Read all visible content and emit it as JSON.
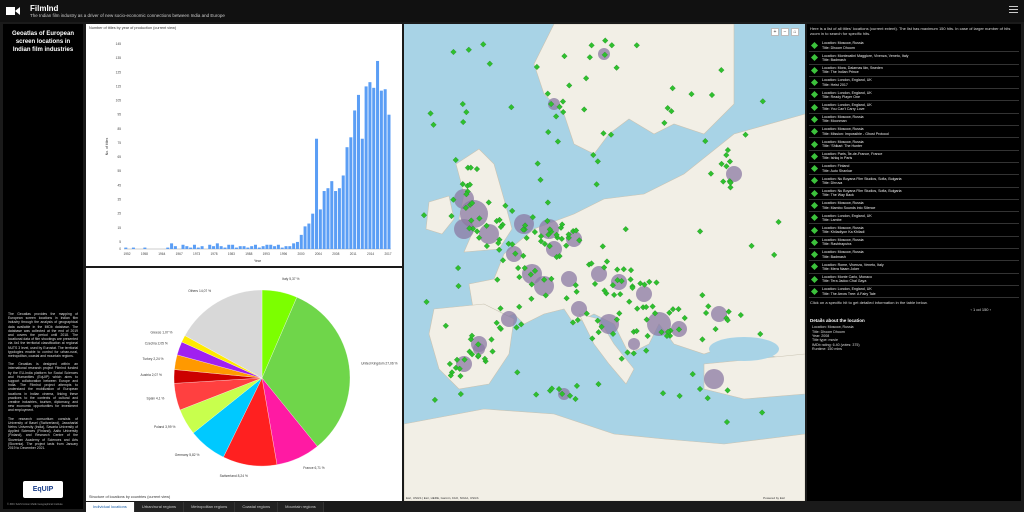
{
  "header": {
    "title": "FilmInd",
    "subtitle": "The Indian film industry as a driver of new socio-economic connections between India and Europe"
  },
  "left": {
    "heading": "Geoatlas of European screen locations in Indian film industries",
    "paragraphs": [
      "The Geoatlas provides the mapping of European screen locations in Indian film industry through the analysis of geographical data available in the IMDb database. The database was collected at the end of 2019 and covers the period until 2018. The locational data of film shootings are presented via 4x4 the territorial classification at regional NUTS 3 level, used by Eurostat. The territorial typologies enable to control for urban-rural, metropolitan, coastal and mountain regions.",
      "The Geoatlas is designed within an international research project FilmInd funded by the EU-India platform for Social Sciences and Humanities (EqUIP) which aims to support collaboration between Europe and India. The FilmInd project attempts to understand the mobilization of European locations in Indian cinema, linking these practices to the contexts of cultural and creative industries, tourism, diplomacy, and new economic opportunities for investment and employment.",
      "The research consortium consists of University of Basel (Switzerland), Jawaharlal Nehru University (India), Savaria University of Applied Sciences (Finland), Aalto University (Finland), and Research Centre of the Slovenian Academy of Sciences and Arts (Slovenia). The project lasts from January 2019 to December 2021."
    ],
    "logo": "EqUIP",
    "copyright": "© ZRC SAZU Anton Melik Geographical Institute"
  },
  "bar_chart": {
    "title": "Number of titles by year of production (current view)"
  },
  "pie_chart": {
    "title": "Structure of locations by countries (current view)"
  },
  "chart_data": [
    {
      "type": "bar",
      "title": "Number of titles by year of production (current view)",
      "xlabel": "Year",
      "ylabel": "No. of titles",
      "x": [
        1952,
        1953,
        1954,
        1955,
        1956,
        1957,
        1958,
        1959,
        1960,
        1961,
        1962,
        1963,
        1964,
        1965,
        1966,
        1967,
        1968,
        1969,
        1970,
        1971,
        1972,
        1973,
        1974,
        1975,
        1976,
        1977,
        1978,
        1979,
        1980,
        1981,
        1982,
        1983,
        1984,
        1985,
        1986,
        1987,
        1988,
        1989,
        1990,
        1991,
        1992,
        1993,
        1994,
        1995,
        1996,
        1997,
        1998,
        1999,
        2000,
        2001,
        2002,
        2003,
        2004,
        2005,
        2006,
        2007,
        2008,
        2009,
        2010,
        2011,
        2012,
        2013,
        2014,
        2015,
        2016,
        2017,
        2018
      ],
      "values": [
        1,
        0,
        1,
        0,
        0,
        1,
        0,
        0,
        0,
        0,
        0,
        1,
        4,
        2,
        0,
        3,
        2,
        1,
        3,
        1,
        2,
        0,
        3,
        2,
        4,
        2,
        1,
        3,
        3,
        1,
        2,
        2,
        1,
        2,
        3,
        1,
        2,
        3,
        3,
        2,
        3,
        1,
        2,
        2,
        4,
        5,
        10,
        16,
        18,
        25,
        78,
        28,
        41,
        43,
        48,
        41,
        43,
        52,
        72,
        79,
        98,
        109,
        78,
        115,
        118,
        114,
        133,
        112,
        113,
        95
      ],
      "xticks": [
        "1952",
        "1958",
        "1964",
        "1967",
        "1973",
        "1978",
        "1983",
        "1988",
        "1993",
        "1996",
        "2000",
        "2004",
        "2008",
        "2011",
        "2014",
        "2017"
      ],
      "ylim": [
        0,
        145
      ],
      "yticks": [
        0,
        5,
        15,
        25,
        35,
        45,
        55,
        65,
        75,
        85,
        95,
        105,
        115,
        125,
        135,
        145
      ],
      "color": "#5b9ef5"
    },
    {
      "type": "pie",
      "title": "Structure of locations by countries (current view)",
      "labels": [
        "Italy 5,37 %",
        "United Kingdom 27,06 %",
        "France 6,71 %",
        "Switzerland 8,24 %",
        "Germany 5,82 %",
        "Poland 3,99 %",
        "Spain 4,1 %",
        "Austria 2,07 %",
        "Turkey 2,24 %",
        "Czechia 2,05 %",
        "Greece 1,07 %",
        "Others 14,07 %"
      ],
      "values": [
        5.37,
        27.06,
        6.71,
        8.24,
        5.82,
        3.99,
        4.1,
        2.07,
        2.24,
        2.05,
        1.07,
        14.07
      ],
      "colors": [
        "#7cff00",
        "#6fd64a",
        "#ff1aa3",
        "#ff2020",
        "#00c9ff",
        "#c8ff4d",
        "#ff4040",
        "#cc0000",
        "#ff9900",
        "#a020f0",
        "#ffea00",
        "#d8d8d8"
      ]
    }
  ],
  "map": {
    "attribution": "Esri, USGS | Esri, HERE, Garmin, FAO, NOAA, USGS",
    "powered": "Powered by Esri",
    "labels": [
      "Atlantic Ocean",
      "Saint Petersburg",
      "Moscow",
      "Kyiv",
      "Istanbul",
      "Mediterranean Sea",
      "Black Sea"
    ]
  },
  "right": {
    "intro": "Here is a list of all titles' locations (current extent). The list has maximum 150 hits. In case of larger number of hits zoom in to search for specific hits.",
    "items": [
      {
        "location": "Location: Moscow, Russia",
        "title": "Title: Dhoom Dhoom"
      },
      {
        "location": "Location: Montecatini Maggiore, Vivenza, Veneto, Italy",
        "title": "Title: Badmash"
      },
      {
        "location": "Location: Mora, Dalarnas län, Sweden",
        "title": "Title: The Indian Prince"
      },
      {
        "location": "Location: London, England, UK",
        "title": "Title: Heist 2017"
      },
      {
        "location": "Location: London, England, UK",
        "title": "Title: Ready Player One"
      },
      {
        "location": "Location: London, England, UK",
        "title": "Title: You Can't Carry Love"
      },
      {
        "location": "Location: Moscow, Russia",
        "title": "Title: Moonman"
      },
      {
        "location": "Location: Moscow, Russia",
        "title": "Title: Mission: Impossible - Ghost Protocol"
      },
      {
        "location": "Location: Moscow, Russia",
        "title": "Title: 'Shikari: The Hunter"
      },
      {
        "location": "Location: Paris, Île-de-France, France",
        "title": "Title: Ishkq in Paris"
      },
      {
        "location": "Location: Finland",
        "title": "Title: Auto Shankar"
      },
      {
        "location": "Location: Nu Boyana Film Studios, Sofia, Bulgaria",
        "title": "Title: Dhruva"
      },
      {
        "location": "Location: Nu Boyana Film Studios, Sofia, Bulgaria",
        "title": "Title: The Way Back"
      },
      {
        "location": "Location: Moscow, Russia",
        "title": "Title: Mambo Sounds into Silence"
      },
      {
        "location": "Location: London, England, UK",
        "title": "Title: Lambe"
      },
      {
        "location": "Location: Moscow, Russia",
        "title": "Title: Khiladiyon Ka Khiladi"
      },
      {
        "location": "Location: Moscow, Russia",
        "title": "Title: Rashtraputra"
      },
      {
        "location": "Location: Moscow, Russia",
        "title": "Title: Badmash"
      },
      {
        "location": "Location: Rome, Vivenza, Veneto, Italy",
        "title": "Title: Mera Naam Joker"
      },
      {
        "location": "Location: Monte Carlo, Monaco",
        "title": "Title: Tera Jadoo Chal Gaya"
      },
      {
        "location": "Location: London, England, UK",
        "title": "Title: The Arrow Tree: A Fairy Tale"
      }
    ],
    "hint": "Click on a specific hit to get detailed information in the table below.",
    "pager": "1 od 150",
    "details_heading": "Details about the location",
    "details": [
      "Location: Moscow, Russia",
      "Title: Dhoom Dhoom",
      "Year: 2008",
      "Title type: movie",
      "IMDb rating: 6.40 (votes: 375)",
      "Runtime: 150 mins"
    ]
  },
  "tabs": [
    "Individual locations",
    "Urban/rural regions",
    "Metropolitan regions",
    "Coastal regions",
    "Mountain regions"
  ]
}
